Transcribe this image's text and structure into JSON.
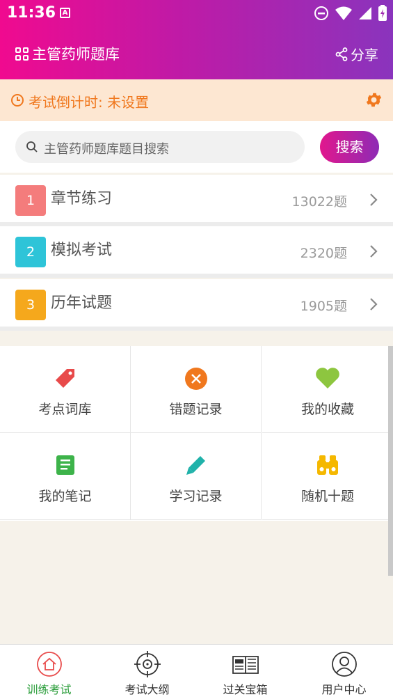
{
  "status_bar": {
    "time": "11:36",
    "notification_glyph": "A"
  },
  "header": {
    "title": "主管药师题库",
    "share_label": "分享"
  },
  "countdown": {
    "text": "考试倒计时: 未设置",
    "accent": "#f0781e"
  },
  "search": {
    "placeholder": "主管药师题库题目搜索",
    "button_label": "搜索"
  },
  "categories": [
    {
      "num": "1",
      "label": "章节练习",
      "count": "13022题",
      "color": "#f47c7c"
    },
    {
      "num": "2",
      "label": "模拟考试",
      "count": "2320题",
      "color": "#2ec4d8"
    },
    {
      "num": "3",
      "label": "历年试题",
      "count": "1905题",
      "color": "#f5a81c"
    }
  ],
  "tools": [
    {
      "label": "考点词库",
      "icon": "tag-icon"
    },
    {
      "label": "错题记录",
      "icon": "error-circle-icon"
    },
    {
      "label": "我的收藏",
      "icon": "heart-icon"
    },
    {
      "label": "我的笔记",
      "icon": "note-icon"
    },
    {
      "label": "学习记录",
      "icon": "pencil-icon"
    },
    {
      "label": "随机十题",
      "icon": "binoculars-icon"
    }
  ],
  "bottom_nav": [
    {
      "label": "训练考试",
      "icon": "home-icon",
      "active": true
    },
    {
      "label": "考试大纲",
      "icon": "target-icon",
      "active": false
    },
    {
      "label": "过关宝箱",
      "icon": "newspaper-icon",
      "active": false
    },
    {
      "label": "用户中心",
      "icon": "user-icon",
      "active": false
    }
  ],
  "colors": {
    "brand_start": "#f00a8f",
    "brand_end": "#8a34bd",
    "active_nav": "#2a9d3a"
  }
}
